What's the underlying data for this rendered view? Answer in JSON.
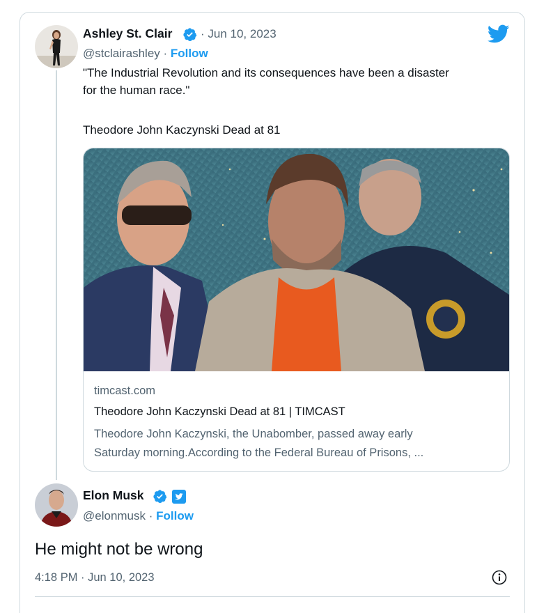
{
  "tweet": {
    "author": "Ashley St. Clair",
    "handle": "@stclairashley",
    "separator": " · ",
    "follow_label": "Follow",
    "date": "· Jun 10, 2023",
    "text_line1": "\"The Industrial Revolution and its consequences have been a disaster",
    "text_line2": "for the human race.\"",
    "text_line3": "Theodore John Kaczynski Dead at 81",
    "link_card": {
      "domain": "timcast.com",
      "title": "Theodore John Kaczynski Dead at 81 | TIMCAST",
      "desc_line1": "Theodore John Kaczynski, the Unabomber, passed away early",
      "desc_line2": "Saturday morning.According to the Federal Bureau of Prisons, ..."
    }
  },
  "reply": {
    "author": "Elon Musk",
    "handle": "@elonmusk",
    "separator": " · ",
    "follow_label": "Follow",
    "text": "He might not be wrong",
    "timestamp": "4:18 PM · Jun 10, 2023"
  },
  "colors": {
    "accent": "#1d9bf0",
    "text": "#0f1419",
    "secondary": "#536471",
    "border": "#cfd9de"
  },
  "icons": [
    "twitter-bird-icon",
    "verified-badge-icon",
    "twitter-square-badge-icon",
    "info-icon"
  ]
}
